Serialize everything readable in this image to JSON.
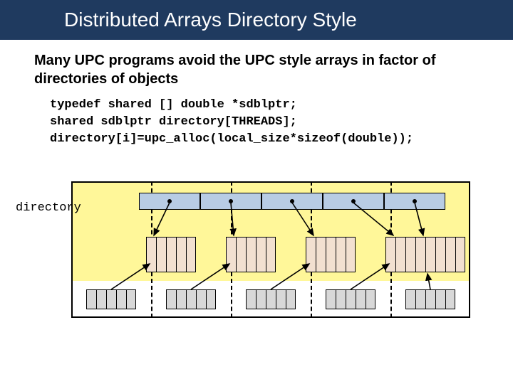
{
  "title": "Distributed Arrays Directory Style",
  "subtitle": "Many UPC programs avoid the UPC style arrays in factor of directories of objects",
  "code": {
    "line1": "typedef shared [] double *sdblptr;",
    "line2": "shared sdblptr directory[THREADS];",
    "line3": "directory[i]=upc_alloc(local_size*sizeof(double));"
  },
  "diagram": {
    "label": "directory",
    "columns": 5,
    "mid_cells_per_column": 5,
    "bot_cells_per_column": 5
  }
}
